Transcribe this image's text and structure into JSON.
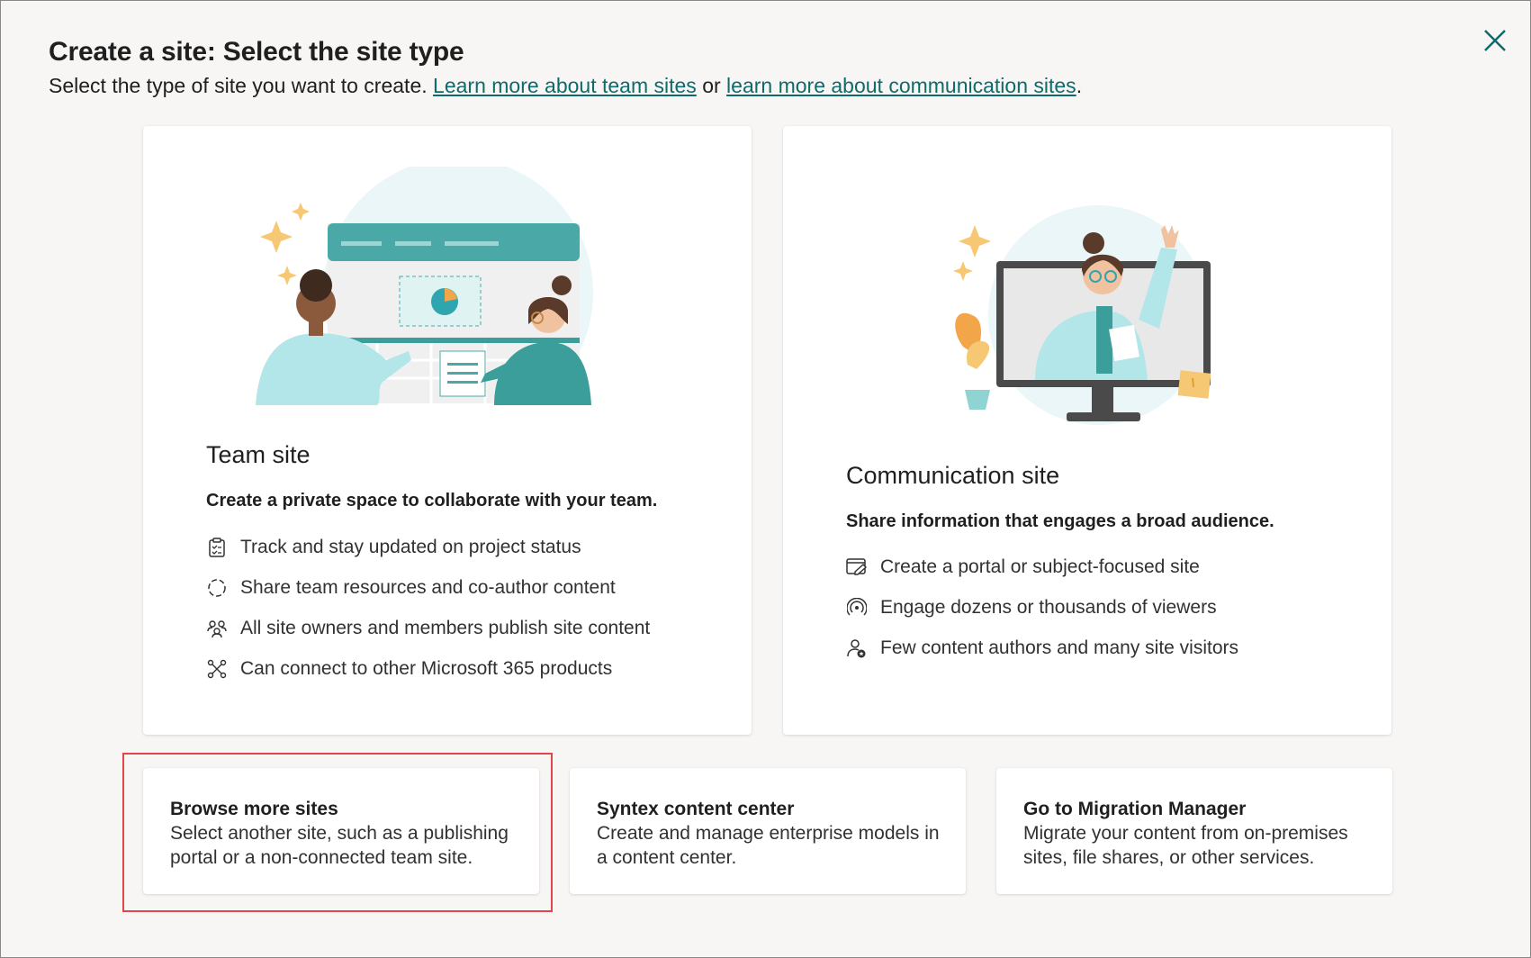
{
  "dialog": {
    "title": "Create a site: Select the site type",
    "subtitle_prefix": "Select the type of site you want to create. ",
    "link_team": "Learn more about team sites",
    "subtitle_or": " or ",
    "link_comm": "learn more about communication sites",
    "subtitle_suffix": ".",
    "close_icon": "close-icon"
  },
  "team_site": {
    "title": "Team site",
    "description": "Create a private space to collaborate with your team.",
    "features": [
      {
        "icon": "clipboard-checklist-icon",
        "label": "Track and stay updated on project status"
      },
      {
        "icon": "sync-circle-icon",
        "label": "Share team resources and co-author content"
      },
      {
        "icon": "people-team-icon",
        "label": "All site owners and members publish site content"
      },
      {
        "icon": "connector-icon",
        "label": "Can connect to other Microsoft 365 products"
      }
    ]
  },
  "communication_site": {
    "title": "Communication site",
    "description": "Share information that engages a broad audience.",
    "features": [
      {
        "icon": "window-edit-icon",
        "label": "Create a portal or subject-focused site"
      },
      {
        "icon": "broadcast-icon",
        "label": "Engage dozens or thousands of viewers"
      },
      {
        "icon": "person-star-icon",
        "label": "Few content authors and many site visitors"
      }
    ]
  },
  "options": [
    {
      "title": "Browse more sites",
      "description": "Select another site, such as a publishing portal or a non-connected team site."
    },
    {
      "title": "Syntex content center",
      "description": "Create and manage enterprise models in a content center."
    },
    {
      "title": "Go to Migration Manager",
      "description": "Migrate your content from on-premises sites, file shares, or other services."
    }
  ],
  "colors": {
    "accent_link": "#0f6b6b",
    "highlight_border": "#e0474c",
    "teal": "#4aa9a7",
    "light_teal": "#b2e6e8"
  }
}
